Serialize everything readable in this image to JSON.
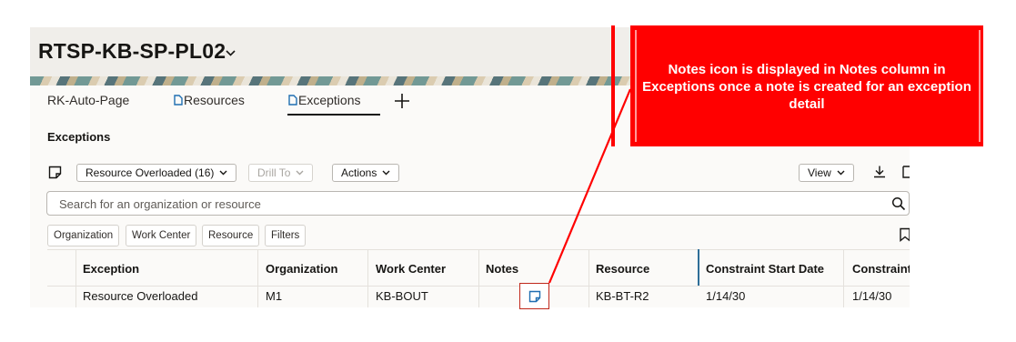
{
  "header": {
    "title": "RTSP-KB-SP-PL02"
  },
  "tabs": [
    {
      "label": "RK-Auto-Page"
    },
    {
      "label": "Resources"
    },
    {
      "label": "Exceptions"
    }
  ],
  "section": {
    "title": "Exceptions"
  },
  "toolbar": {
    "resource_select": "Resource Overloaded (16)",
    "drill_to": "Drill To",
    "actions": "Actions",
    "view": "View"
  },
  "search": {
    "placeholder": "Search for an organization or resource"
  },
  "filters": [
    "Organization",
    "Work Center",
    "Resource",
    "Filters"
  ],
  "table": {
    "columns": [
      "Exception",
      "Organization",
      "Work Center",
      "Notes",
      "Resource",
      "Constraint Start Date",
      "Constraint"
    ],
    "rows": [
      {
        "exception": "Resource Overloaded",
        "organization": "M1",
        "work_center": "KB-BOUT",
        "notes_icon": "note-icon",
        "resource": "KB-BT-R2",
        "start_date": "1/14/30",
        "end_date": "1/14/30"
      }
    ]
  },
  "callout": {
    "text": "Notes icon is displayed in Notes column in Exceptions once a note is created for an exception detail"
  },
  "colors": {
    "callout_red": "#ff0000",
    "note_highlight": "#c0281b",
    "accent_blue": "#1f6eb1"
  }
}
